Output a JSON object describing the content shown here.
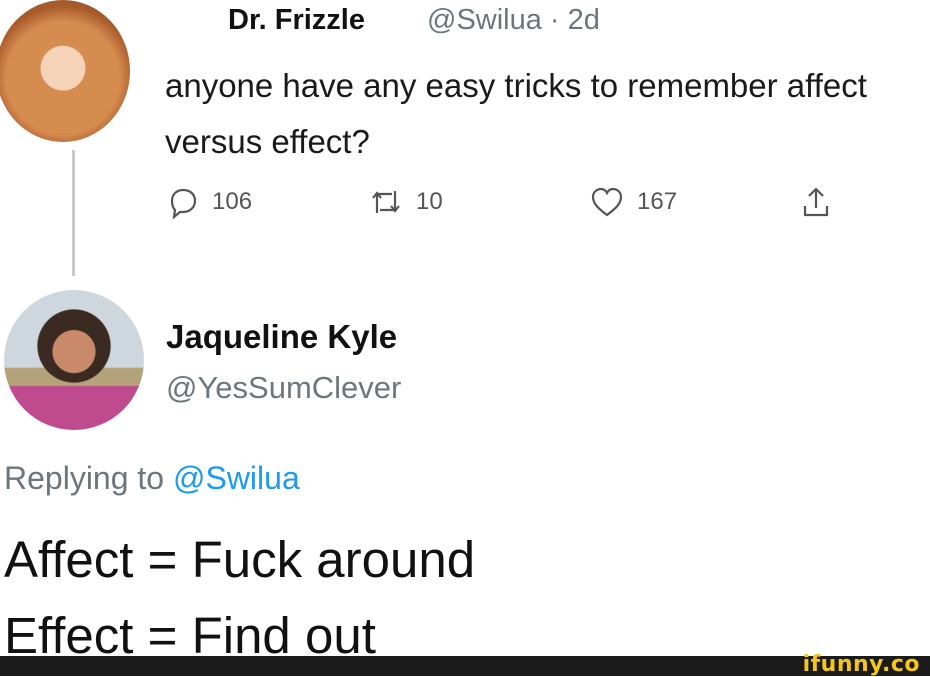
{
  "original_tweet": {
    "author_name": "Dr. Frizzle",
    "handle_time": "@Swilua · 2d",
    "text": "anyone have any easy tricks to remember affect versus effect?",
    "stats": {
      "replies": "106",
      "retweets": "10",
      "likes": "167"
    }
  },
  "reply_tweet": {
    "author_name": "Jaqueline Kyle",
    "handle": "@YesSumClever",
    "replying_prefix": "Replying to ",
    "replying_mention": "@Swilua",
    "line1": "Affect = Fuck around",
    "line2": "Effect = Find out"
  },
  "watermark": "ifunny.co",
  "colors": {
    "mention_blue": "#1d9bf0",
    "muted_gray": "#6e767d",
    "watermark_yellow": "#f5c518"
  }
}
